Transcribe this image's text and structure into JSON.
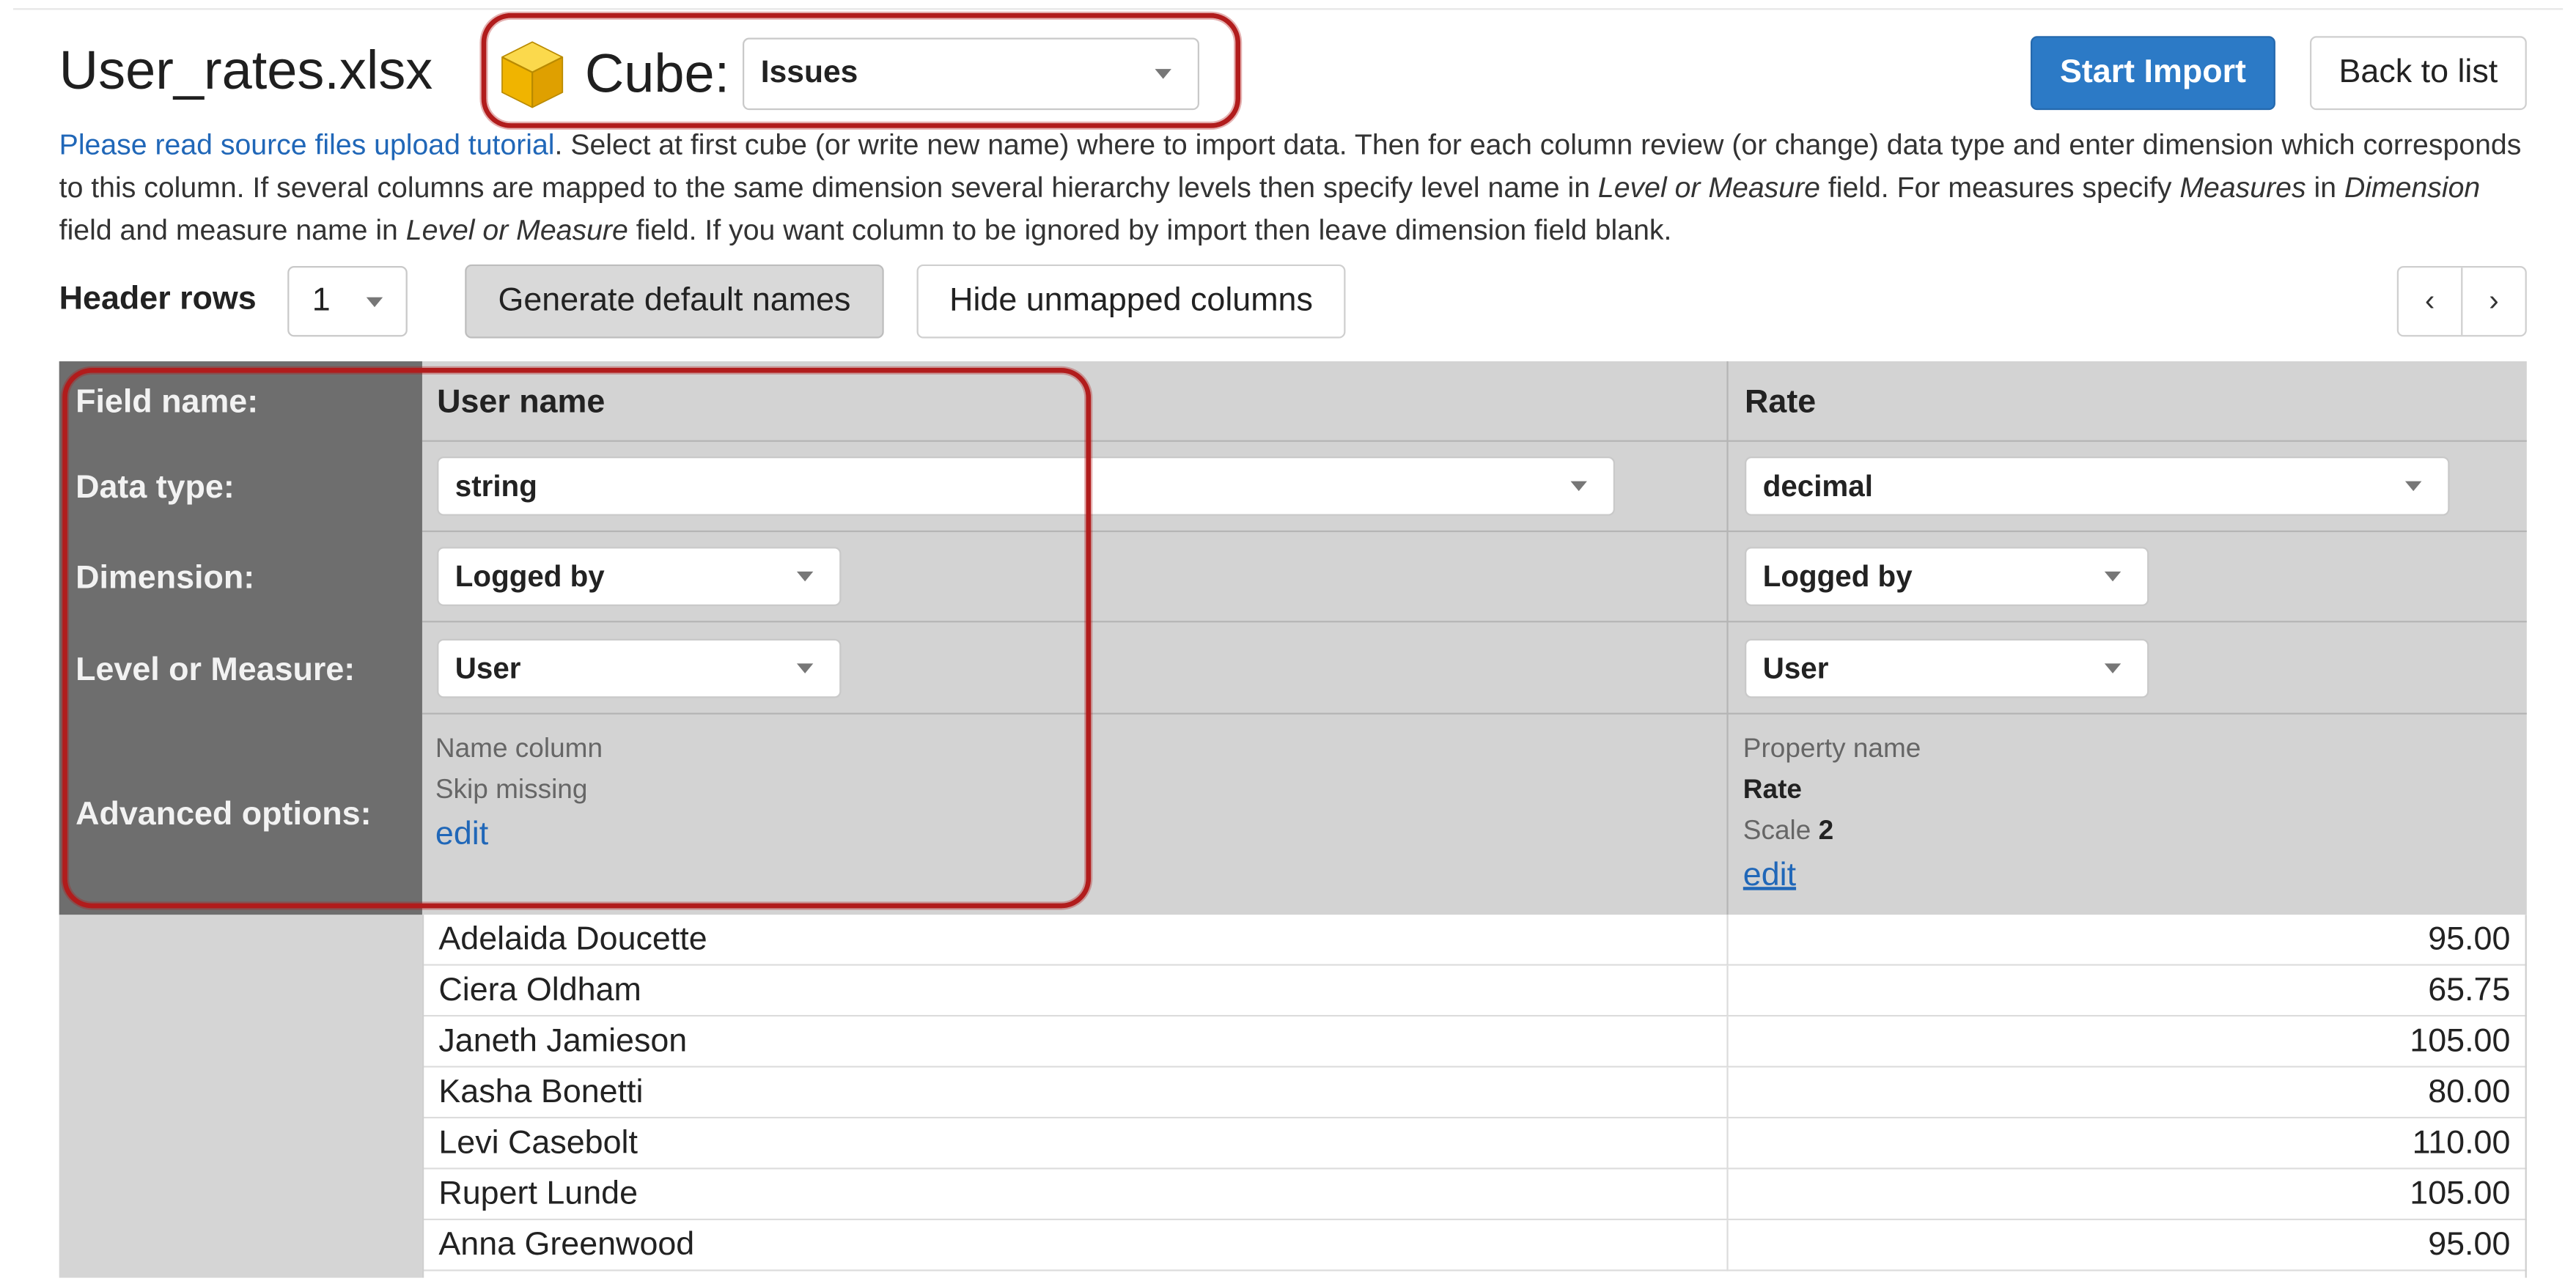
{
  "header": {
    "file_title": "User_rates.xlsx",
    "cube_label": "Cube:",
    "cube_selected": "Issues",
    "start_import": "Start Import",
    "back_to_list": "Back to list"
  },
  "instructions": {
    "link_text": "Please read source files upload tutorial",
    "t1": ". Select at first cube (or write new name) where to import data. Then for each column review (or change) data type and enter dimension which corresponds to this column. If several columns are mapped to the same dimension several hierarchy levels then specify level name in ",
    "i1": "Level or Measure",
    "t2": " field. For measures specify ",
    "i2": "Measures",
    "t3": " in ",
    "i3": "Dimension",
    "t4": " field and measure name in ",
    "i4": "Level or Measure",
    "t5": " field. If you want column to be ignored by import then leave dimension field blank."
  },
  "toolbar": {
    "header_rows_label": "Header rows",
    "header_rows_value": "1",
    "generate_default_names": "Generate default names",
    "hide_unmapped_columns": "Hide unmapped columns",
    "prev": "‹",
    "next": "›"
  },
  "labels": {
    "field_name": "Field name:",
    "data_type": "Data type:",
    "dimension": "Dimension:",
    "level_or_measure": "Level or Measure:",
    "advanced_options": "Advanced options:"
  },
  "columns": [
    {
      "field_name": "User name",
      "data_type": "string",
      "dimension": "Logged by",
      "level": "User",
      "adv_line1": "Name column",
      "adv_line2": "Skip missing",
      "edit": "edit"
    },
    {
      "field_name": "Rate",
      "data_type": "decimal",
      "dimension": "Logged by",
      "level": "User",
      "adv_line1": "Property name",
      "adv_line2": "Rate",
      "adv_scale_label": "Scale",
      "adv_scale_value": "2",
      "edit": "edit"
    }
  ],
  "rows": [
    {
      "name": "Adelaida Doucette",
      "rate": "95.00"
    },
    {
      "name": "Ciera Oldham",
      "rate": "65.75"
    },
    {
      "name": "Janeth Jamieson",
      "rate": "105.00"
    },
    {
      "name": "Kasha Bonetti",
      "rate": "80.00"
    },
    {
      "name": "Levi Casebolt",
      "rate": "110.00"
    },
    {
      "name": "Rupert Lunde",
      "rate": "105.00"
    },
    {
      "name": "Anna Greenwood",
      "rate": "95.00"
    }
  ],
  "colors": {
    "primary": "#2c7ac6",
    "link": "#2067b8",
    "callout": "#b11c1c",
    "label_column": "#6e6e6e",
    "mapping_background": "#d3d3d3"
  },
  "icons": {
    "cube": "cube-icon",
    "caret": "caret-down-icon"
  }
}
